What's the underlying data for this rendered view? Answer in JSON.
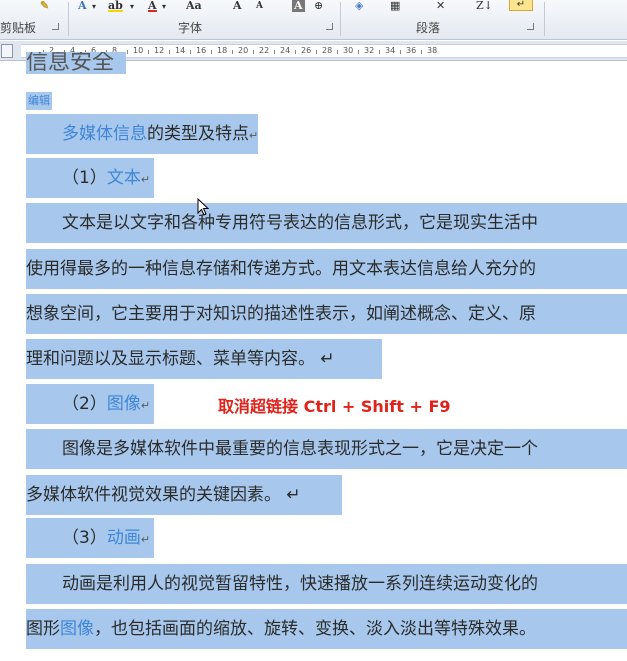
{
  "ribbon": {
    "clipboard_label": "剪贴板",
    "font_label": "字体",
    "paragraph_label": "段落",
    "font_buttons": [
      "A",
      "A",
      "A",
      "Aa",
      "A",
      "A",
      "A"
    ],
    "sort_label": "Z↓",
    "highlight_label": "↵"
  },
  "ruler": {
    "numbers": [
      "2",
      "4",
      "6",
      "8",
      "10",
      "12",
      "14",
      "16",
      "18",
      "20",
      "22",
      "24",
      "26",
      "28",
      "30",
      "32",
      "34",
      "36",
      "38"
    ]
  },
  "document": {
    "title_fragment": "信息安全",
    "tag": "编辑",
    "heading": {
      "link": "多媒体信息",
      "text": "的类型及特点",
      "mark": "↵"
    },
    "sections": [
      {
        "number": "（1）",
        "name": "文本",
        "mark": "↵",
        "lines": [
          "文本是以文字和各种专用符号表达的信息形式，它是现实生活中",
          "使用得最多的一种信息存储和传递方式。用文本表达信息给人充分的",
          "想象空间，它主要用于对知识的描述性表示，如阐述概念、定义、原",
          "理和问题以及显示标题、菜单等内容。 ↵"
        ]
      },
      {
        "number": "（2）",
        "name": "图像",
        "mark": "↵",
        "lines": [
          "图像是多媒体软件中最重要的信息表现形式之一，它是决定一个",
          "多媒体软件视觉效果的关键因素。 ↵"
        ]
      },
      {
        "number": "（3）",
        "name": "动画",
        "mark": "↵",
        "lines": [
          "动画是利用人的视觉暂留特性，快速播放一系列连续运动变化的",
          "，也包括画面的缩放、旋转、变换、淡入淡出等特殊效果。"
        ],
        "line2_prefix": "图形",
        "line2_link": "图像"
      }
    ]
  },
  "annotation": {
    "shortcut_text": "取消超链接 Ctrl + Shift + F9",
    "color": "#e0221a"
  },
  "colors": {
    "selection": "#a7c8ec",
    "link": "#3f86d8"
  }
}
